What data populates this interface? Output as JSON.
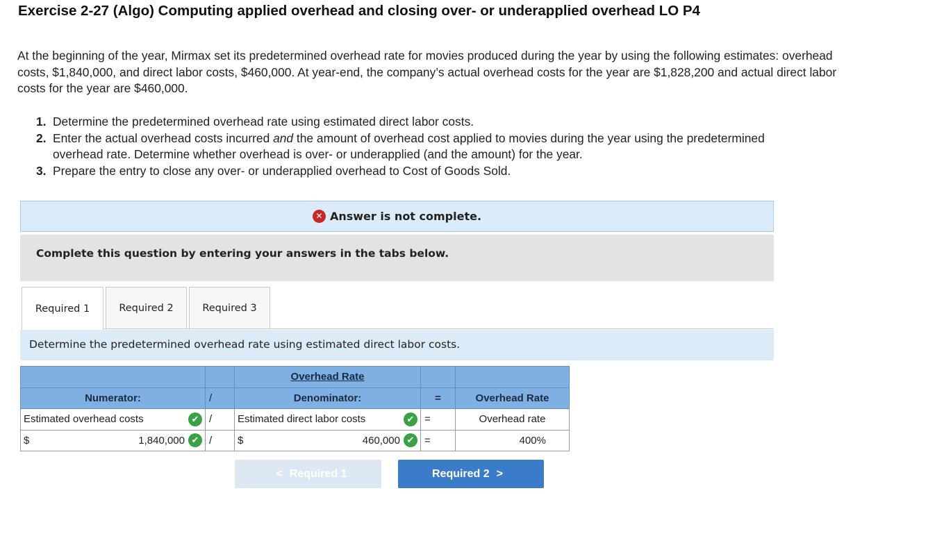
{
  "title": "Exercise 2-27 (Algo) Computing applied overhead and closing over- or underapplied overhead LO P4",
  "intro": "At the beginning of the year, Mirmax set its predetermined overhead rate for movies produced during the year by using the following estimates: overhead costs, $1,840,000, and direct labor costs, $460,000. At year-end, the company’s actual overhead costs for the year are $1,828,200 and actual direct labor costs for the year are $460,000.",
  "requirements": [
    {
      "num": "1.",
      "text": "Determine the predetermined overhead rate using estimated direct labor costs."
    },
    {
      "num": "2.",
      "pre": "Enter the actual overhead costs incurred ",
      "em": "and",
      "post": " the amount of overhead cost applied to movies during the year using the predetermined overhead rate. Determine whether overhead is over- or underapplied (and the amount) for the year."
    },
    {
      "num": "3.",
      "text": "Prepare the entry to close any over- or underapplied overhead to Cost of Goods Sold."
    }
  ],
  "banner": {
    "icon": "error-x-icon",
    "text": "Answer is not complete."
  },
  "instructions": "Complete this question by entering your answers in the tabs below.",
  "tabs": [
    {
      "label": "Required 1",
      "active": true
    },
    {
      "label": "Required 2",
      "active": false
    },
    {
      "label": "Required 3",
      "active": false
    }
  ],
  "prompt": "Determine the predetermined overhead rate using estimated direct labor costs.",
  "table": {
    "caption": "Overhead Rate",
    "header": {
      "numerator": "Numerator:",
      "divide": "/",
      "denominator": "Denominator:",
      "equals": "=",
      "result": "Overhead Rate"
    },
    "row1": {
      "numerator": "Estimated overhead costs",
      "divide": "/",
      "denominator": "Estimated direct labor costs",
      "equals": "=",
      "result": "Overhead rate"
    },
    "row2": {
      "currency_num": "$",
      "numerator_value": "1,840,000",
      "divide": "/",
      "currency_den": "$",
      "denominator_value": "460,000",
      "equals": "=",
      "result": "400%"
    }
  },
  "nav": {
    "prev_label": "Required 1",
    "next_label": "Required 2",
    "prev_enabled": false
  },
  "colors": {
    "accent": "#3a7cc7",
    "header_blue": "#7fb0e3",
    "banner_bg": "#dcebf8",
    "check_green": "#3aa244",
    "error_red": "#c62828"
  }
}
